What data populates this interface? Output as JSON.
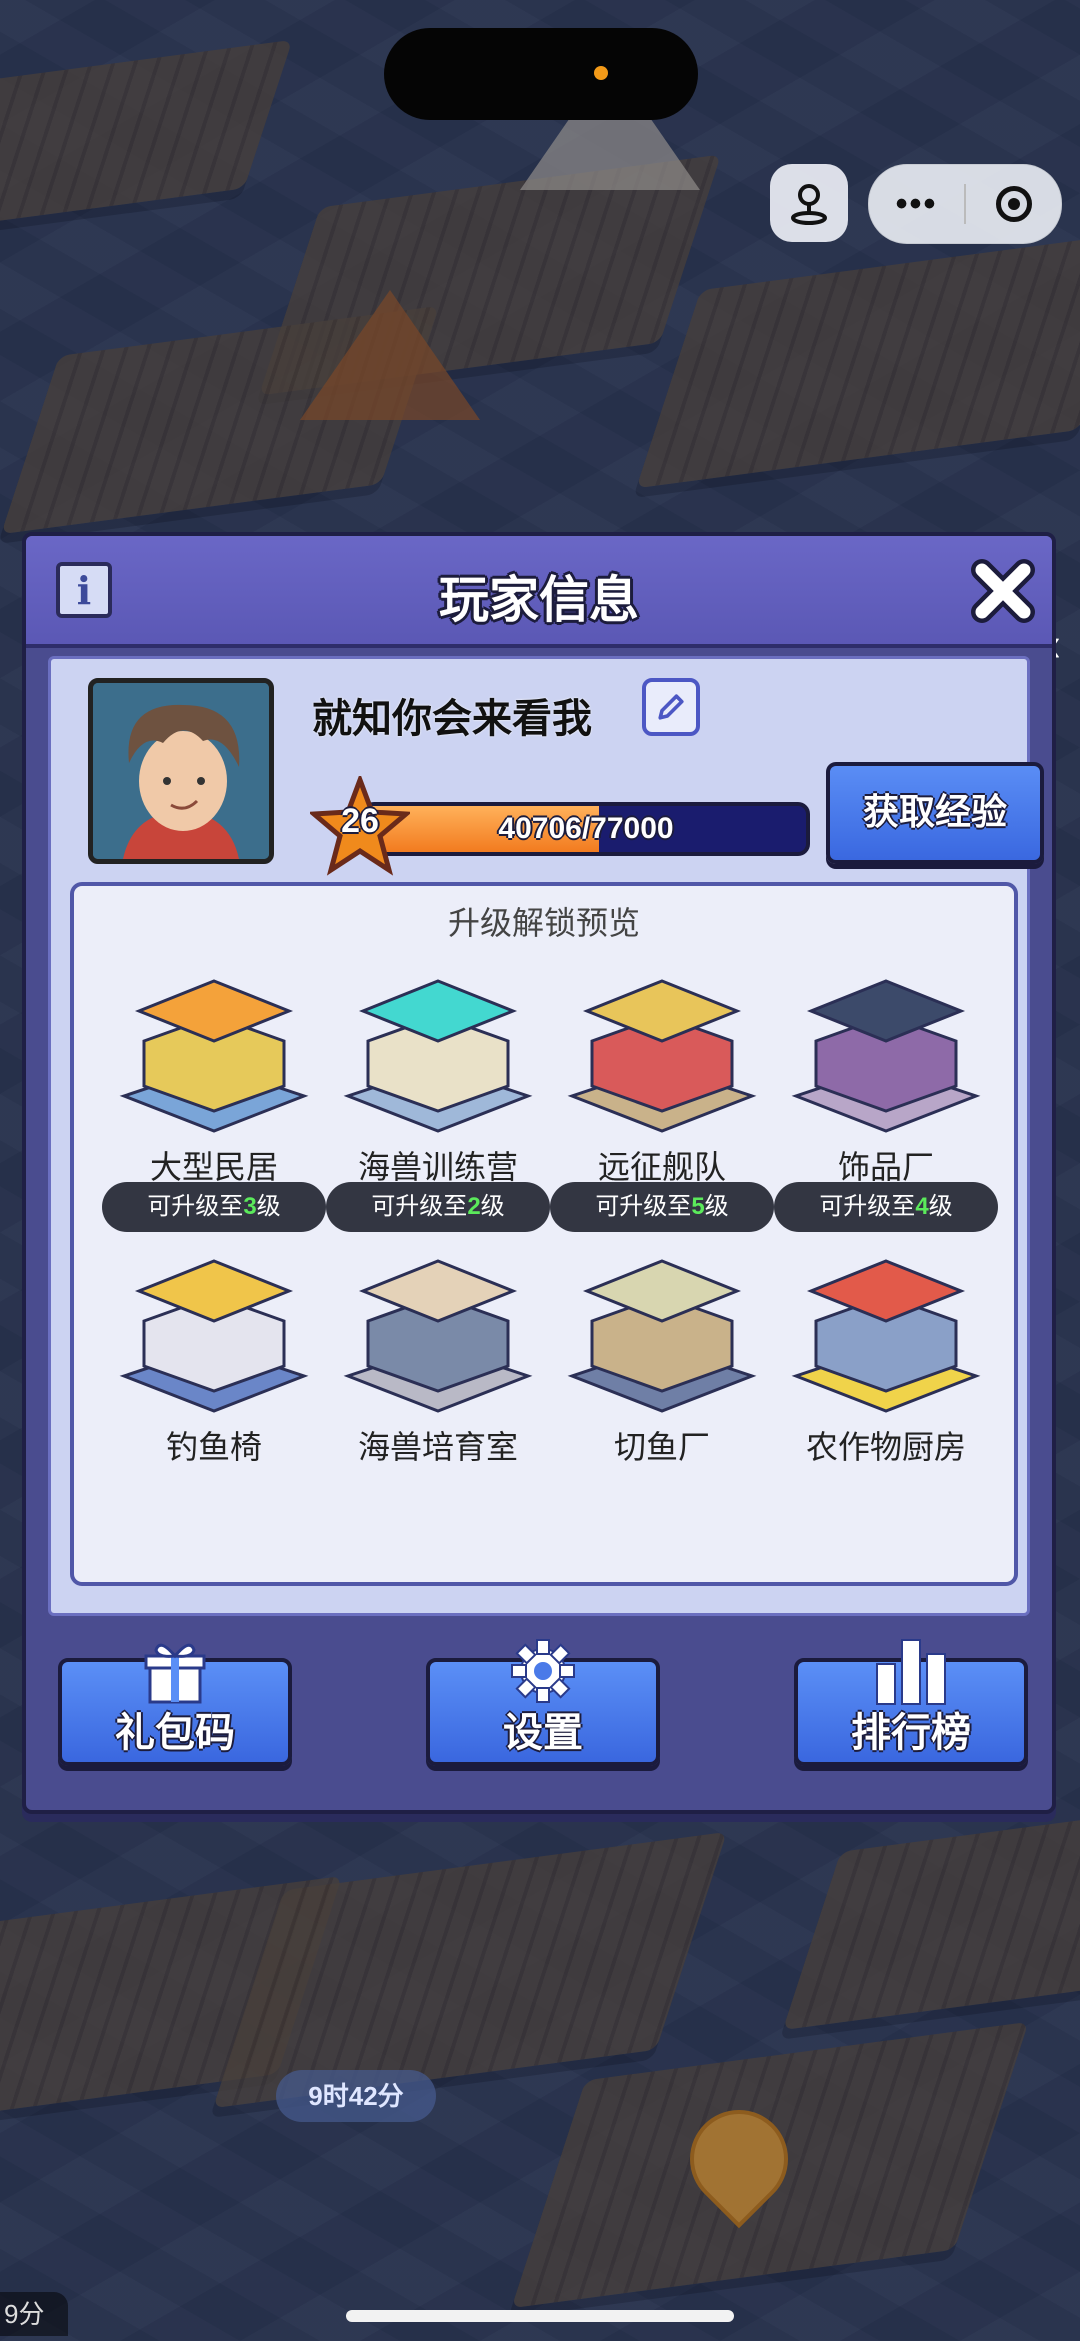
{
  "system": {
    "more_glyph": "•••",
    "timer": "9时42分",
    "corner_time": "9分"
  },
  "modal": {
    "title": "玩家信息",
    "info_glyph": "i"
  },
  "player": {
    "name": "就知你会来看我",
    "level": "26",
    "xp_text": "40706/77000",
    "xp_progress": 0.5286,
    "get_exp_label": "获取经验"
  },
  "preview": {
    "title": "升级解锁预览",
    "buildings": [
      {
        "label": "大型民居",
        "icon": "residence-icon"
      },
      {
        "label": "海兽训练营",
        "icon": "training-camp-icon"
      },
      {
        "label": "远征舰队",
        "icon": "fleet-icon"
      },
      {
        "label": "饰品厂",
        "icon": "accessory-factory-icon"
      },
      {
        "label": "钓鱼椅",
        "icon": "fishing-chair-icon",
        "badge_pre": "可升级至",
        "badge_level": "3",
        "badge_post": "级"
      },
      {
        "label": "海兽培育室",
        "icon": "breeding-room-icon",
        "badge_pre": "可升级至",
        "badge_level": "2",
        "badge_post": "级"
      },
      {
        "label": "切鱼厂",
        "icon": "fish-cutting-icon",
        "badge_pre": "可升级至",
        "badge_level": "5",
        "badge_post": "级"
      },
      {
        "label": "农作物厨房",
        "icon": "crop-kitchen-icon",
        "badge_pre": "可升级至",
        "badge_level": "4",
        "badge_post": "级"
      }
    ]
  },
  "bottom_buttons": {
    "gift": "礼包码",
    "settings": "设置",
    "ranking": "排行榜"
  },
  "colors": {
    "modal_bg": "#4a4c8f",
    "button_blue": "#3a67df",
    "xp_fill": "#f27b1f",
    "badge_level": "#5bea5b"
  }
}
